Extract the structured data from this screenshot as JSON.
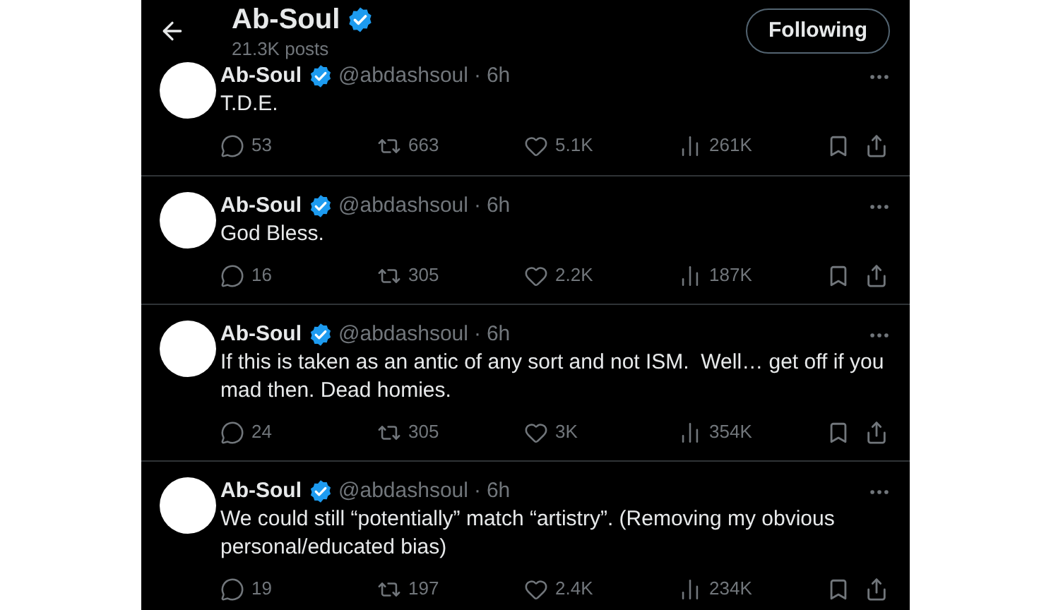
{
  "header": {
    "name": "Ab-Soul",
    "verified": true,
    "post_count": "21.3K posts",
    "follow_button": "Following"
  },
  "tweets": [
    {
      "name": "Ab-Soul",
      "verified": true,
      "handle": "@abdashsoul",
      "separator": "·",
      "time": "6h",
      "text": "T.D.E.",
      "replies": "53",
      "reposts": "663",
      "likes": "5.1K",
      "views": "261K"
    },
    {
      "name": "Ab-Soul",
      "verified": true,
      "handle": "@abdashsoul",
      "separator": "·",
      "time": "6h",
      "text": "God Bless.",
      "replies": "16",
      "reposts": "305",
      "likes": "2.2K",
      "views": "187K"
    },
    {
      "name": "Ab-Soul",
      "verified": true,
      "handle": "@abdashsoul",
      "separator": "·",
      "time": "6h",
      "text": "If this is taken as an antic of any sort and not ISM.  Well… get off if you mad then. Dead homies.",
      "replies": "24",
      "reposts": "305",
      "likes": "3K",
      "views": "354K"
    },
    {
      "name": "Ab-Soul",
      "verified": true,
      "handle": "@abdashsoul",
      "separator": "·",
      "time": "6h",
      "text": "We could still “potentially” match “artistry”. (Removing my obvious personal/educated bias)",
      "replies": "19",
      "reposts": "197",
      "likes": "2.4K",
      "views": "234K"
    }
  ]
}
